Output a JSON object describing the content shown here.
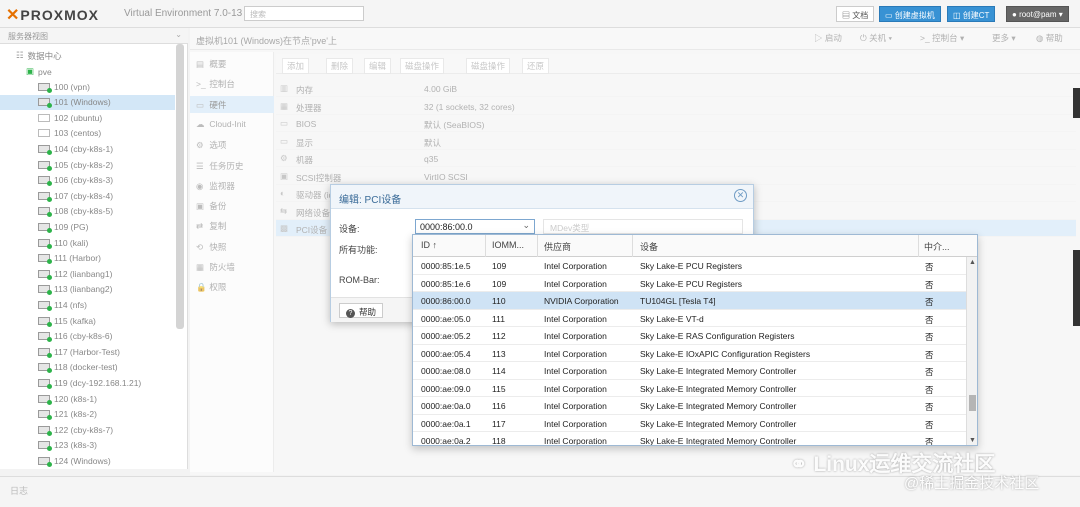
{
  "app": {
    "logo": "PROXMOX",
    "version": "Virtual Environment 7.0-13",
    "search_placeholder": "搜索",
    "doc_label": "文档",
    "create_vm_label": "创建虚拟机",
    "create_ct_label": "创建CT",
    "user_label": "root@pam"
  },
  "tree": {
    "view_label": "服务器视图",
    "datacenter": "数据中心",
    "node": "pve",
    "items": [
      {
        "label": "100 (vpn)",
        "state": "on"
      },
      {
        "label": "101 (Windows)",
        "state": "on"
      },
      {
        "label": "102 (ubuntu)",
        "state": "template"
      },
      {
        "label": "103 (centos)",
        "state": "template"
      },
      {
        "label": "104 (cby-k8s-1)",
        "state": "on"
      },
      {
        "label": "105 (cby-k8s-2)",
        "state": "on"
      },
      {
        "label": "106 (cby-k8s-3)",
        "state": "on"
      },
      {
        "label": "107 (cby-k8s-4)",
        "state": "on"
      },
      {
        "label": "108 (cby-k8s-5)",
        "state": "on"
      },
      {
        "label": "109 (PG)",
        "state": "on"
      },
      {
        "label": "110 (kali)",
        "state": "on"
      },
      {
        "label": "111 (Harbor)",
        "state": "on"
      },
      {
        "label": "112 (lianbang1)",
        "state": "on"
      },
      {
        "label": "113 (lianbang2)",
        "state": "on"
      },
      {
        "label": "114 (nfs)",
        "state": "on"
      },
      {
        "label": "115 (kafka)",
        "state": "on"
      },
      {
        "label": "116 (cby-k8s-6)",
        "state": "on"
      },
      {
        "label": "117 (Harbor-Test)",
        "state": "on"
      },
      {
        "label": "118 (docker-test)",
        "state": "on"
      },
      {
        "label": "119 (dcy-192.168.1.21)",
        "state": "on"
      },
      {
        "label": "120 (k8s-1)",
        "state": "on"
      },
      {
        "label": "121 (k8s-2)",
        "state": "on"
      },
      {
        "label": "122 (cby-k8s-7)",
        "state": "on"
      },
      {
        "label": "123 (k8s-3)",
        "state": "on"
      },
      {
        "label": "124 (Windows)",
        "state": "on"
      }
    ]
  },
  "status_bar": "日志",
  "content": {
    "title": "虚拟机101 (Windows)在节点'pve'上",
    "actions": [
      "启动",
      "关机",
      "控制台",
      "更多",
      "帮助"
    ]
  },
  "subnav": [
    "概要",
    "控制台",
    "硬件",
    "Cloud-Init",
    "选项",
    "任务历史",
    "监视器",
    "备份",
    "复制",
    "快照",
    "防火墙",
    "权限"
  ],
  "hw_toolbar": [
    "添加",
    "删除",
    "编辑",
    "磁盘操作",
    "磁盘操作",
    "还原"
  ],
  "hardware": [
    {
      "key": "内存",
      "value": "4.00 GiB"
    },
    {
      "key": "处理器",
      "value": "32 (1 sockets, 32 cores)"
    },
    {
      "key": "BIOS",
      "value": "默认 (SeaBIOS)"
    },
    {
      "key": "显示",
      "value": "默认"
    },
    {
      "key": "机器",
      "value": "q35"
    },
    {
      "key": "SCSI控制器",
      "value": "VirtIO SCSI"
    },
    {
      "key": "驱动器 (ide2)",
      "value": ""
    },
    {
      "key": "网络设备",
      "value": ""
    },
    {
      "key": "PCI设备",
      "value": ""
    }
  ],
  "dialog": {
    "title": "编辑: PCI设备",
    "device_label": "设备:",
    "device_value": "0000:86:00.0",
    "mdev_placeholder": "MDev类型",
    "all_functions_label": "所有功能:",
    "rombar_label": "ROM-Bar:",
    "help_label": "帮助"
  },
  "pci_grid": {
    "columns": [
      "ID ↑",
      "IOMM...",
      "供应商",
      "设备",
      "中介..."
    ],
    "rows": [
      {
        "id": "0000:85:1e.5",
        "iommu": "109",
        "vendor": "Intel Corporation",
        "device": "Sky Lake-E PCU Registers",
        "mdev": "否"
      },
      {
        "id": "0000:85:1e.6",
        "iommu": "109",
        "vendor": "Intel Corporation",
        "device": "Sky Lake-E PCU Registers",
        "mdev": "否"
      },
      {
        "id": "0000:86:00.0",
        "iommu": "110",
        "vendor": "NVIDIA Corporation",
        "device": "TU104GL [Tesla T4]",
        "mdev": "否"
      },
      {
        "id": "0000:ae:05.0",
        "iommu": "111",
        "vendor": "Intel Corporation",
        "device": "Sky Lake-E VT-d",
        "mdev": "否"
      },
      {
        "id": "0000:ae:05.2",
        "iommu": "112",
        "vendor": "Intel Corporation",
        "device": "Sky Lake-E RAS Configuration Registers",
        "mdev": "否"
      },
      {
        "id": "0000:ae:05.4",
        "iommu": "113",
        "vendor": "Intel Corporation",
        "device": "Sky Lake-E IOxAPIC Configuration Registers",
        "mdev": "否"
      },
      {
        "id": "0000:ae:08.0",
        "iommu": "114",
        "vendor": "Intel Corporation",
        "device": "Sky Lake-E Integrated Memory Controller",
        "mdev": "否"
      },
      {
        "id": "0000:ae:09.0",
        "iommu": "115",
        "vendor": "Intel Corporation",
        "device": "Sky Lake-E Integrated Memory Controller",
        "mdev": "否"
      },
      {
        "id": "0000:ae:0a.0",
        "iommu": "116",
        "vendor": "Intel Corporation",
        "device": "Sky Lake-E Integrated Memory Controller",
        "mdev": "否"
      },
      {
        "id": "0000:ae:0a.1",
        "iommu": "117",
        "vendor": "Intel Corporation",
        "device": "Sky Lake-E Integrated Memory Controller",
        "mdev": "否"
      },
      {
        "id": "0000:ae:0a.2",
        "iommu": "118",
        "vendor": "Intel Corporation",
        "device": "Sky Lake-E Integrated Memory Controller",
        "mdev": "否"
      }
    ]
  },
  "watermark": {
    "line1": "Linux运维交流社区",
    "line2": "@稀土掘金技术社区"
  },
  "colors": {
    "accent": "#3892d4",
    "selection": "#cfe3f5",
    "logo_x": "#e57000",
    "running": "#2db34a"
  }
}
